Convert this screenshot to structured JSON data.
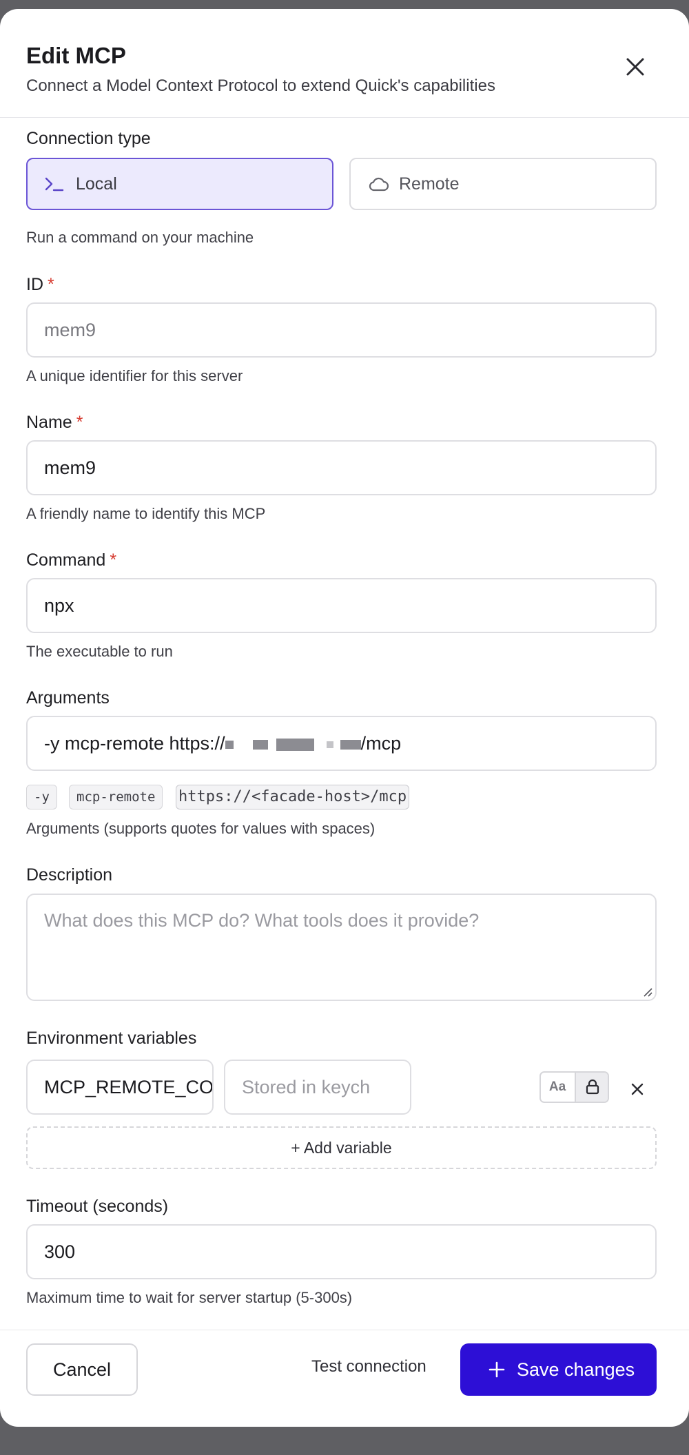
{
  "dialog": {
    "title": "Edit MCP",
    "subtitle": "Connect a Model Context Protocol to extend Quick's capabilities"
  },
  "connection": {
    "label": "Connection type",
    "options": [
      {
        "label": "Local",
        "icon": "terminal-icon",
        "selected": true
      },
      {
        "label": "Remote",
        "icon": "cloud-icon",
        "selected": false
      }
    ],
    "hint": "Run a command on your machine"
  },
  "id_field": {
    "label": "ID",
    "required_mark": "*",
    "value": "mem9",
    "hint": "A unique identifier for this server"
  },
  "name_field": {
    "label": "Name",
    "required_mark": "*",
    "value": "mem9",
    "hint": "A friendly name to identify this MCP"
  },
  "command_field": {
    "label": "Command",
    "required_mark": "*",
    "value": "npx",
    "hint": "The executable to run"
  },
  "arguments_field": {
    "label": "Arguments",
    "value_prefix": "-y mcp-remote https://",
    "value_suffix": "/mcp",
    "chips": [
      "-y",
      "mcp-remote",
      "https://<facade-host>/mcp"
    ],
    "hint": "Arguments (supports quotes for values with spaces)"
  },
  "description_field": {
    "label": "Description",
    "placeholder": "What does this MCP do? What tools does it provide?"
  },
  "env": {
    "label": "Environment variables",
    "key": "MCP_REMOTE_CO",
    "value_placeholder": "Stored in keych",
    "toggle_text_label": "Aa",
    "add_label": "+ Add variable"
  },
  "timeout_field": {
    "label": "Timeout (seconds)",
    "value": "300",
    "hint": "Maximum time to wait for server startup (5-300s)"
  },
  "footer": {
    "cancel": "Cancel",
    "test": "Test connection",
    "save": "Save changes"
  },
  "colors": {
    "accent": "#2d0fd6",
    "selected_bg": "#eceafd",
    "selected_border": "#6b55d6",
    "required": "#d63a2f"
  }
}
